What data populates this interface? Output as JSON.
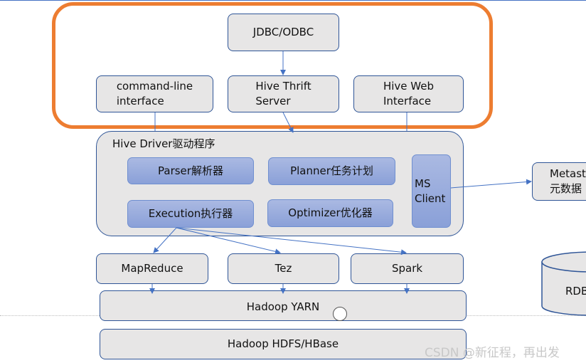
{
  "colors": {
    "accent": "#ed7d31",
    "border": "#2f5597",
    "box_fill": "#e7e6e6",
    "component_fill": "#8aa0d8",
    "arrow": "#4472c4"
  },
  "clients": {
    "jdbc": "JDBC/ODBC",
    "cli": [
      "command-line",
      "interface"
    ],
    "thrift": [
      "Hive Thrift",
      "Server"
    ],
    "web": [
      "Hive Web",
      "Interface"
    ]
  },
  "driver": {
    "title": "Hive Driver驱动程序",
    "parser": "Parser解析器",
    "planner": "Planner任务计划",
    "execution": "Execution执行器",
    "optimizer": "Optimizer优化器",
    "ms_client": [
      "MS",
      "Client"
    ]
  },
  "metastore": [
    "Metastore",
    "元数据"
  ],
  "rdb": "RDBMS",
  "engines": {
    "mapreduce": "MapReduce",
    "tez": "Tez",
    "spark": "Spark"
  },
  "yarn": "Hadoop YARN",
  "hdfs": "Hadoop HDFS/HBase",
  "watermark": "CSDN @新征程，再出发"
}
